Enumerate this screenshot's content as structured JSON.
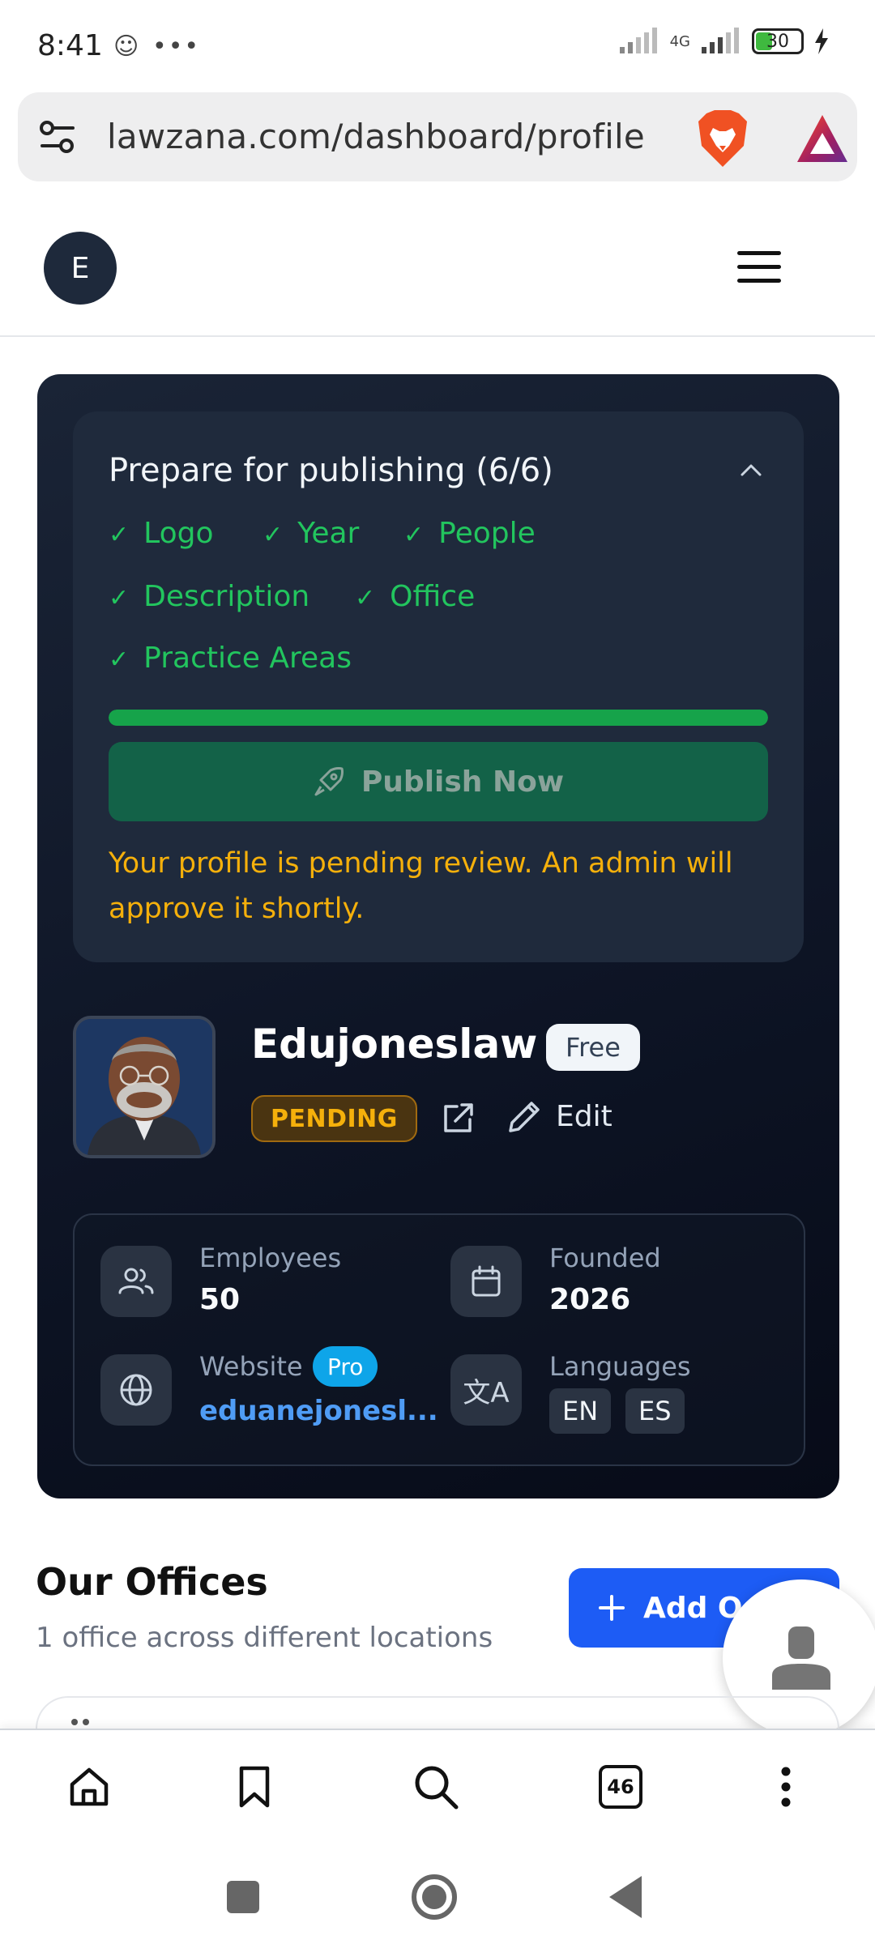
{
  "status_bar": {
    "time": "8:41",
    "network": "4G",
    "battery": "30"
  },
  "browser": {
    "url": "lawzana.com/dashboard/profile",
    "tabs_count": "46"
  },
  "header": {
    "avatar_initial": "E"
  },
  "publishing": {
    "title": "Prepare for publishing (6/6)",
    "checks": [
      "Logo",
      "Year",
      "People",
      "Description",
      "Office",
      "Practice Areas"
    ],
    "progress_percent": 100,
    "publish_button": "Publish Now",
    "pending_message": "Your profile is pending review. An admin will approve it shortly."
  },
  "profile": {
    "name": "Edujoneslaw",
    "plan_badge": "Free",
    "status_badge": "PENDING",
    "edit_label": "Edit"
  },
  "stats": {
    "employees_label": "Employees",
    "employees_value": "50",
    "founded_label": "Founded",
    "founded_value": "2026",
    "website_label": "Website",
    "website_badge": "Pro",
    "website_value": "eduanejonesl...",
    "languages_label": "Languages",
    "languages": [
      "EN",
      "ES"
    ]
  },
  "offices": {
    "title": "Our Offices",
    "subtitle": "1 office across different locations",
    "add_button": "Add O"
  },
  "colors": {
    "success": "#22c55e",
    "warning": "#f5b00b",
    "primary": "#1d5cf5",
    "pro_badge": "#0ea5e9"
  },
  "icons": [
    "tune-icon",
    "brave-lion-icon",
    "triangle-logo-icon",
    "menu-icon",
    "chevron-up-icon",
    "check-icon",
    "rocket-icon",
    "external-link-icon",
    "pencil-icon",
    "users-icon",
    "calendar-icon",
    "globe-icon",
    "translate-icon",
    "plus-icon",
    "user-icon",
    "home-icon",
    "bookmark-icon",
    "search-icon",
    "more-icon"
  ]
}
